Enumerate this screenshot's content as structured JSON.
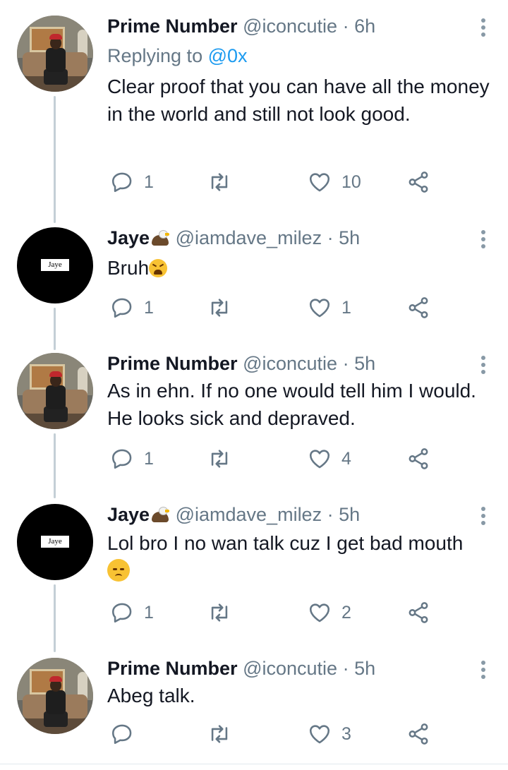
{
  "tweets": [
    {
      "name": "Prime Number",
      "handle": "@iconcutie",
      "time": "· 6h",
      "replying_label": "Replying to",
      "replying_handle": "@0x",
      "text": "Clear proof that you can have all the money in the world and still not look good.",
      "replies": "1",
      "retweets": "",
      "likes": "10",
      "avatar": "photo"
    },
    {
      "name": "Jaye",
      "handle": "@iamdave_milez",
      "time": "· 5h",
      "text": "Bruh",
      "replies": "1",
      "retweets": "",
      "likes": "1",
      "avatar": "logo",
      "avatar_text": "Jaye"
    },
    {
      "name": "Prime Number",
      "handle": "@iconcutie",
      "time": "· 5h",
      "text": "As in ehn. If no one would tell him I would. He looks sick and depraved.",
      "replies": "1",
      "retweets": "",
      "likes": "4",
      "avatar": "photo"
    },
    {
      "name": "Jaye",
      "handle": "@iamdave_milez",
      "time": "· 5h",
      "text": "Lol bro I no wan talk cuz I get bad mouth",
      "replies": "1",
      "retweets": "",
      "likes": "2",
      "avatar": "logo",
      "avatar_text": "Jaye"
    },
    {
      "name": "Prime Number",
      "handle": "@iconcutie",
      "time": "· 5h",
      "text": "Abeg talk.",
      "replies": "",
      "retweets": "",
      "likes": "3",
      "avatar": "photo"
    }
  ],
  "icons": {
    "reply": "reply-bubble-icon",
    "retweet": "retweet-icon",
    "like": "heart-icon",
    "share": "share-icon",
    "more": "more-vertical-icon"
  },
  "colors": {
    "link": "#1d9bf0",
    "muted": "#657786",
    "thread_line": "#c4cfd6"
  }
}
